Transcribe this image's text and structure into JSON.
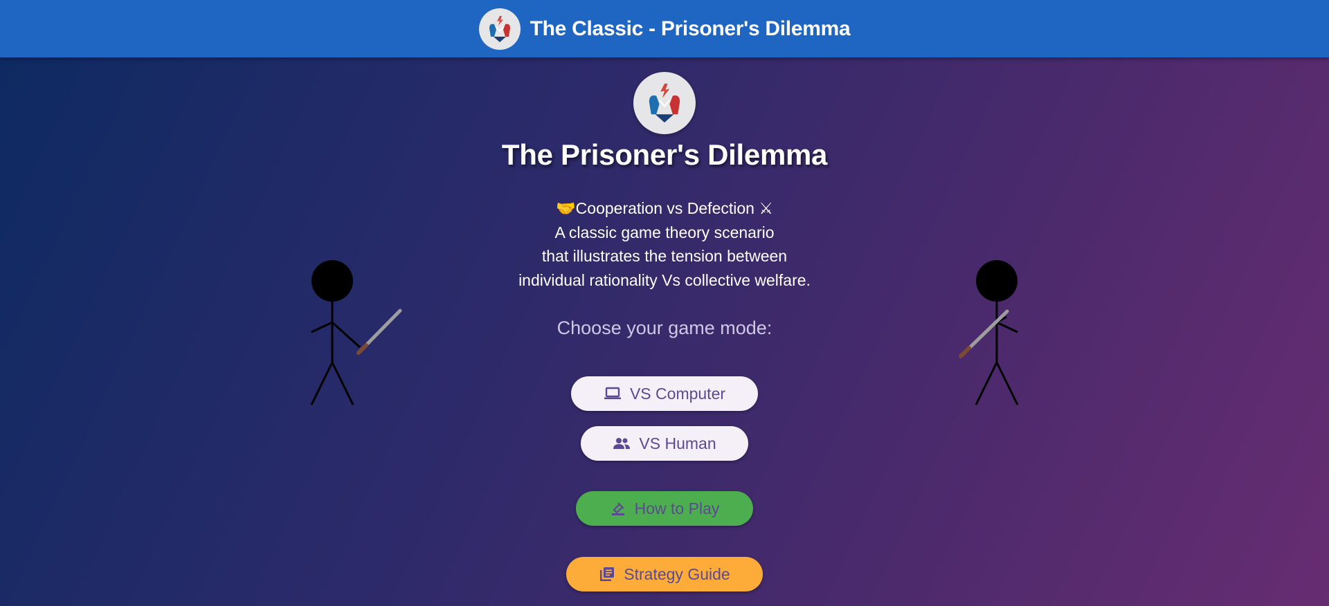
{
  "appbar": {
    "title": "The Classic - Prisoner's Dilemma",
    "logo_icon": "prisoners-dilemma-logo"
  },
  "hero": {
    "logo_icon": "prisoners-dilemma-logo",
    "title": "The Prisoner's Dilemma",
    "description": [
      "🤝Cooperation vs Defection ⚔",
      "A classic game theory scenario",
      "that illustrates the tension between",
      "individual rationality Vs collective welfare."
    ],
    "choose_prompt": "Choose your game mode:"
  },
  "buttons": {
    "vs_computer": {
      "label": "VS Computer",
      "icon": "laptop-icon"
    },
    "vs_human": {
      "label": "VS Human",
      "icon": "people-icon"
    },
    "how_to_play": {
      "label": "How to Play",
      "icon": "gavel-icon"
    },
    "strategy_guide": {
      "label": "Strategy Guide",
      "icon": "library-books-icon"
    }
  },
  "figures": {
    "left": "stick-figure-with-sword",
    "right": "stick-figure-with-sword"
  },
  "colors": {
    "appbar": "#1f66c2",
    "gradient_start": "#0d2a62",
    "gradient_end": "#672c72",
    "button_light": "#f5eff8",
    "button_green": "#4cae4f",
    "button_orange": "#fdac3a",
    "button_text": "#5b4a92"
  }
}
